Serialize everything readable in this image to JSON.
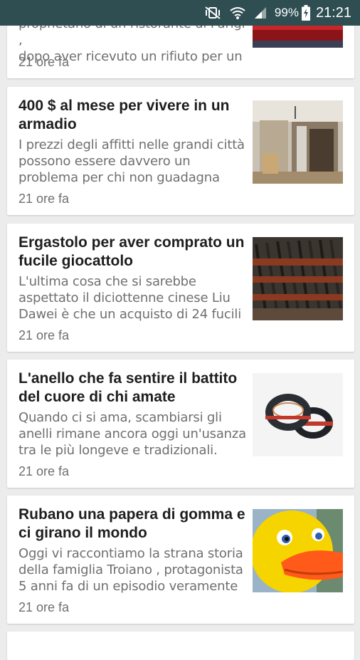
{
  "status_bar": {
    "battery_percent": "99%",
    "time": "21:21",
    "icons": [
      "vibrate-mute-icon",
      "wifi-icon",
      "signal-icon",
      "battery-charging-icon"
    ]
  },
  "articles": [
    {
      "title": "",
      "summary_line1": "propnetano di un ristorante di Parigi ,",
      "summary_line2": "dopo aver ricevuto un rifiuto per un",
      "time": "21 ore fa",
      "thumb": "red-storefront-image"
    },
    {
      "title": "400 $ al mese per vivere in un armadio",
      "summary": "I prezzi degli affitti nelle grandi città possono essere davvero un problema per chi non guadagna",
      "time": "21 ore fa",
      "thumb": "closet-room-image"
    },
    {
      "title": "Ergastolo per aver comprato un fucile giocattolo",
      "summary": "L'ultima cosa che si sarebbe aspettato il diciottenne cinese Liu Dawei è che un acquisto di 24 fucili",
      "time": "21 ore fa",
      "thumb": "rifles-rack-image"
    },
    {
      "title": "L'anello che fa sentire il battito del cuore di chi amate",
      "summary": "Quando ci si ama, scambiarsi gli anelli rimane ancora oggi un'usanza tra le più longeve e tradizionali.",
      "time": "21 ore fa",
      "thumb": "rings-image"
    },
    {
      "title": "Rubano una papera di gomma e ci girano il mondo",
      "summary": "Oggi vi raccontiamo la strana storia della famiglia Troiano , protagonista 5 anni fa di un episodio veramente",
      "time": "21 ore fa",
      "thumb": "rubber-duck-image"
    }
  ]
}
